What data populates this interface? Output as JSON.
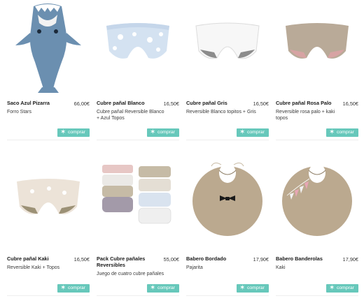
{
  "products": [
    {
      "name": "Saco Azul Pizarra",
      "price": "66,00€",
      "desc": "Forro Stars",
      "buy_label": "comprar"
    },
    {
      "name": "Cubre pañal Blanco",
      "price": "16,50€",
      "desc": "Cubre pañal Reversible Blanco + Azul Topos",
      "buy_label": "comprar"
    },
    {
      "name": "Cubre pañal Gris",
      "price": "16,50€",
      "desc": "Reversible Blanco topitos + Gris",
      "buy_label": "comprar"
    },
    {
      "name": "Cubre pañal Rosa Palo",
      "price": "16,50€",
      "desc": "Reversible rosa palo + kaki topos",
      "buy_label": "comprar"
    },
    {
      "name": "Cubre pañal Kaki",
      "price": "16,50€",
      "desc": "Reversible Kaki + Topos",
      "buy_label": "comprar"
    },
    {
      "name": "Pack Cubre pañales Reversibles",
      "price": "55,00€",
      "desc": "Juego de cuatro cubre pañales",
      "buy_label": "comprar"
    },
    {
      "name": "Babero Bordado",
      "price": "17,90€",
      "desc": "Pajarita",
      "buy_label": "comprar"
    },
    {
      "name": "Babero Banderolas",
      "price": "17,90€",
      "desc": "Kaki",
      "buy_label": "comprar"
    }
  ],
  "colors": {
    "buy_button": "#67c8bb",
    "shark": "#6b8fb0"
  }
}
